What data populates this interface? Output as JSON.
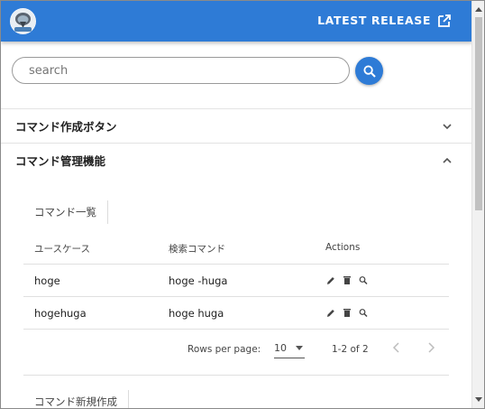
{
  "header": {
    "latest_release_label": "LATEST RELEASE",
    "logo_icon": "robot-logo-icon",
    "bar_color": "#2e7bd6"
  },
  "search": {
    "placeholder": "search",
    "value": ""
  },
  "panels": [
    {
      "title": "コマンド作成ボタン",
      "expanded": false
    },
    {
      "title": "コマンド管理機能",
      "expanded": true
    }
  ],
  "tabs": {
    "list": "コマンド一覧",
    "create": "コマンド新規作成"
  },
  "table": {
    "headers": [
      "ユースケース",
      "検索コマンド",
      "Actions"
    ],
    "rows": [
      {
        "usecase": "hoge",
        "command": "hoge -huga"
      },
      {
        "usecase": "hogehuga",
        "command": "hoge huga"
      }
    ],
    "action_icons": [
      "edit-icon",
      "delete-icon",
      "search-icon"
    ]
  },
  "pagination": {
    "rows_per_page_label": "Rows per page:",
    "rows_per_page": "10",
    "range": "1-2 of 2"
  }
}
